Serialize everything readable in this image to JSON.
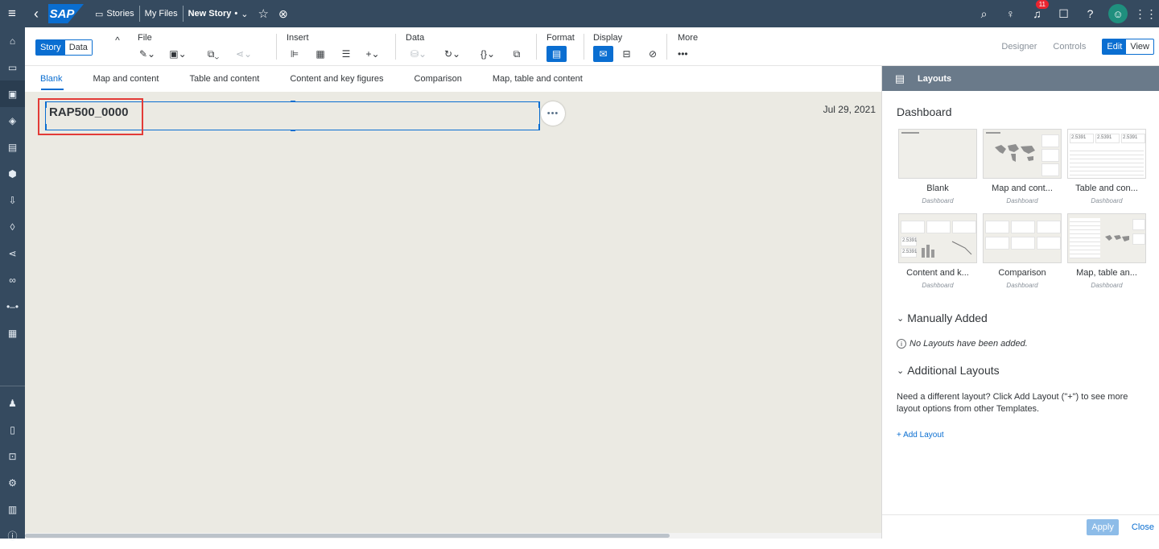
{
  "topbar": {
    "logo": "SAP",
    "stories": "Stories",
    "my_files": "My Files",
    "story_name": "New Story",
    "story_modified_mark": "•",
    "notification_count": "11"
  },
  "toolbar": {
    "story_toggle": "Story",
    "data_toggle": "Data",
    "file": "File",
    "insert": "Insert",
    "data": "Data",
    "format": "Format",
    "display": "Display",
    "more": "More",
    "designer": "Designer",
    "controls": "Controls",
    "edit": "Edit",
    "view": "View"
  },
  "tabs": [
    "Blank",
    "Map and content",
    "Table and content",
    "Content and key figures",
    "Comparison",
    "Map, table and content"
  ],
  "canvas": {
    "title": "RAP500_0000",
    "date": "Jul 29, 2021",
    "more_dots": "•••"
  },
  "panel": {
    "title": "Layouts",
    "section_dashboard": "Dashboard",
    "cards": [
      {
        "name": "Blank",
        "sub": "Dashboard"
      },
      {
        "name": "Map and cont...",
        "sub": "Dashboard"
      },
      {
        "name": "Table and con...",
        "sub": "Dashboard"
      },
      {
        "name": "Content and k...",
        "sub": "Dashboard"
      },
      {
        "name": "Comparison",
        "sub": "Dashboard"
      },
      {
        "name": "Map, table an...",
        "sub": "Dashboard"
      }
    ],
    "thumb_value": "2.5391",
    "manually_added": "Manually Added",
    "no_layouts": "No Layouts have been added.",
    "additional_layouts": "Additional Layouts",
    "description": "Need a different layout? Click Add Layout (\"+\") to see more layout options from other Templates.",
    "add_layout": "+ Add Layout",
    "apply": "Apply",
    "close": "Close"
  },
  "colors": {
    "shell": "#354a5f",
    "accent": "#0a6ed1",
    "highlight": "#e33b37",
    "canvas": "#ebeae3"
  }
}
